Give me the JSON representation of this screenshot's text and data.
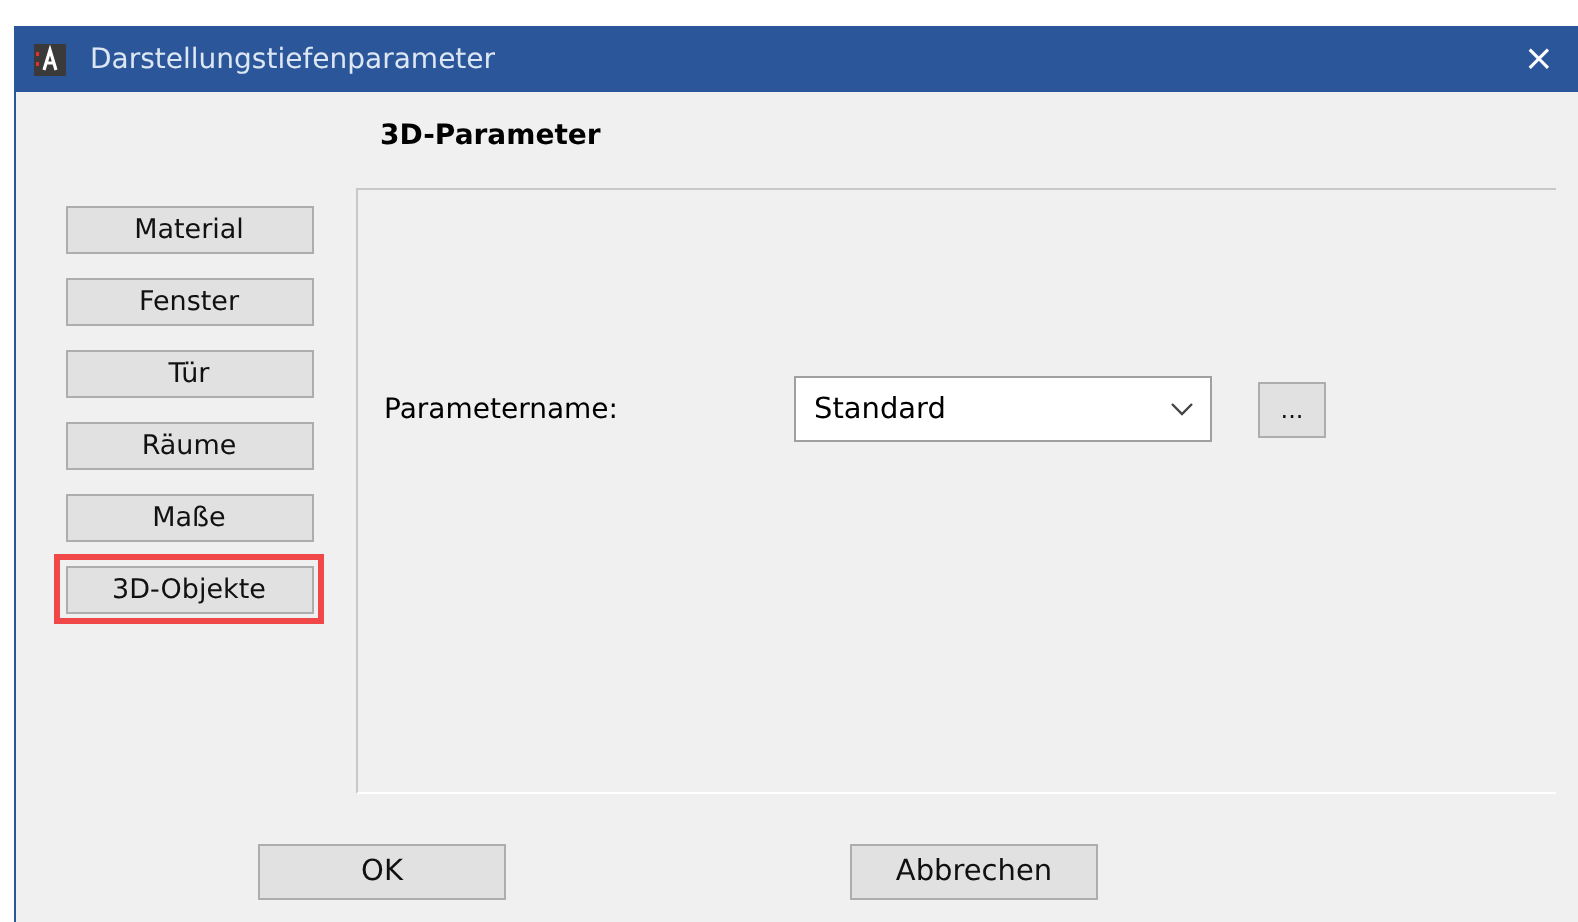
{
  "window": {
    "title": "Darstellungstiefenparameter",
    "close": "×"
  },
  "heading": "3D-Parameter",
  "sidebar": {
    "items": [
      {
        "label": "Material",
        "highlighted": false
      },
      {
        "label": "Fenster",
        "highlighted": false
      },
      {
        "label": "Tür",
        "highlighted": false
      },
      {
        "label": "Räume",
        "highlighted": false
      },
      {
        "label": "Maße",
        "highlighted": false
      },
      {
        "label": "3D-Objekte",
        "highlighted": true
      }
    ]
  },
  "parameter": {
    "label": "Parametername:",
    "value": "Standard",
    "browse": "..."
  },
  "buttons": [
    "OK",
    "Abbrechen"
  ]
}
